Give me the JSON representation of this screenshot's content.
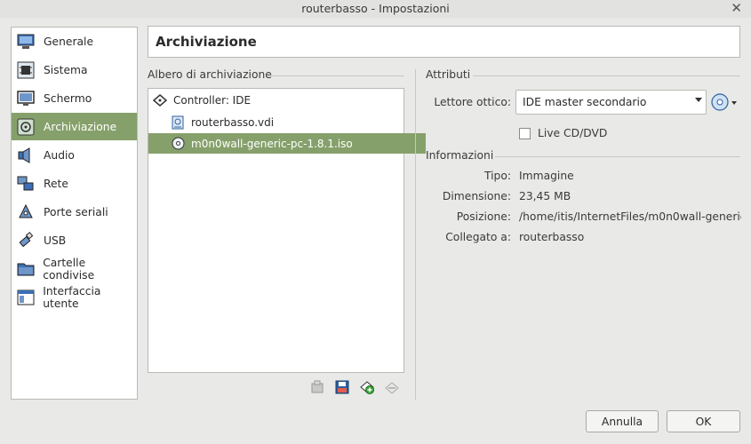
{
  "window": {
    "title": "routerbasso - Impostazioni"
  },
  "sidebar": {
    "items": [
      {
        "label": "Generale",
        "icon": "monitor-icon"
      },
      {
        "label": "Sistema",
        "icon": "chip-icon"
      },
      {
        "label": "Schermo",
        "icon": "display-icon"
      },
      {
        "label": "Archiviazione",
        "icon": "storage-icon",
        "active": true
      },
      {
        "label": "Audio",
        "icon": "speaker-icon"
      },
      {
        "label": "Rete",
        "icon": "network-icon"
      },
      {
        "label": "Porte seriali",
        "icon": "serial-port-icon"
      },
      {
        "label": "USB",
        "icon": "usb-icon"
      },
      {
        "label": "Cartelle condivise",
        "icon": "folder-icon"
      },
      {
        "label": "Interfaccia utente",
        "icon": "ui-window-icon"
      }
    ]
  },
  "header": {
    "title": "Archiviazione"
  },
  "tree": {
    "section_title": "Albero di archiviazione",
    "controller": "Controller: IDE",
    "items": [
      {
        "label": "routerbasso.vdi",
        "icon": "hard-disk-icon"
      },
      {
        "label": "m0n0wall-generic-pc-1.8.1.iso",
        "icon": "optical-disc-icon",
        "selected": true
      }
    ]
  },
  "attributes": {
    "section_title": "Attributi",
    "optical_drive_label": "Lettore ottico:",
    "optical_drive_value": "IDE master secondario",
    "live_cd_label": "Live CD/DVD",
    "live_cd_checked": false
  },
  "info": {
    "section_title": "Informazioni",
    "type_label": "Tipo:",
    "type_value": "Immagine",
    "size_label": "Dimensione:",
    "size_value": "23,45 MB",
    "location_label": "Posizione:",
    "location_value": "/home/itis/InternetFiles/m0n0wall-generic-...",
    "attached_label": "Collegato a:",
    "attached_value": "routerbasso"
  },
  "buttons": {
    "cancel": "Annulla",
    "ok": "OK"
  },
  "colors": {
    "accent": "#86a06b",
    "background": "#e9e9e7"
  }
}
